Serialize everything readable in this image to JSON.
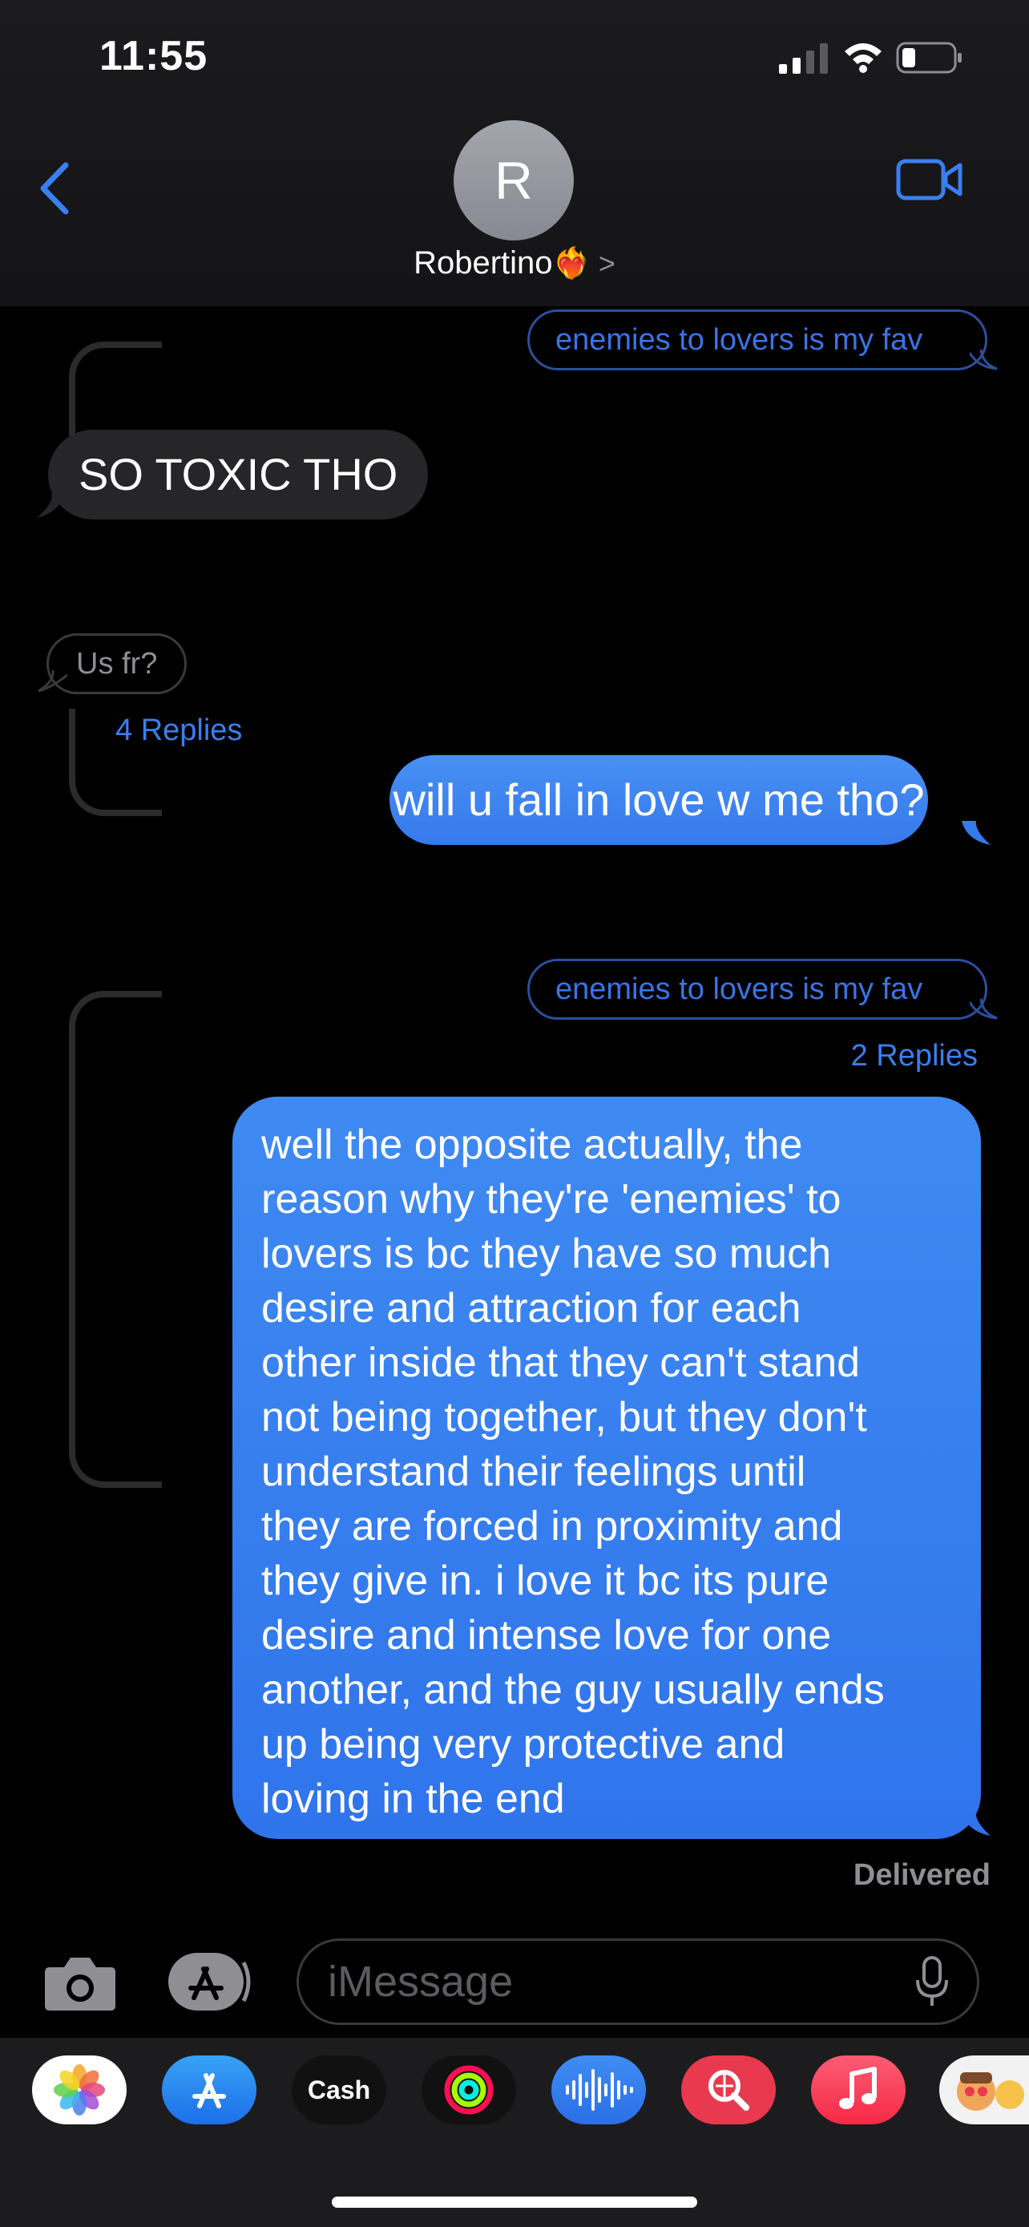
{
  "status": {
    "time": "11:55"
  },
  "header": {
    "avatar_initial": "R",
    "contact_name": "Robertino",
    "contact_emoji": "❤️‍🔥",
    "chevron": ">"
  },
  "messages": {
    "quote_top": "enemies to lovers is my fav",
    "toxic": "SO TOXIC THO",
    "us_fr": "Us fr?",
    "replies_1": "4 Replies",
    "fall_in_love": "will u fall in love w me tho?",
    "quote_second": "enemies to lovers is my fav",
    "replies_2": "2 Replies",
    "long_lines": [
      "well the opposite actually, the",
      "reason why they're 'enemies' to",
      "lovers is bc they have so much",
      "desire and attraction for each",
      "other inside that they can't stand",
      "not being together, but they don't",
      "understand their feelings until",
      "they are forced in proximity and",
      "they give in. i love it bc its pure",
      "desire and intense love for one",
      "another, and the guy usually ends",
      "up being very protective and",
      "loving in the end"
    ],
    "delivered": "Delivered"
  },
  "composer": {
    "placeholder": "iMessage"
  },
  "drawer": {
    "apps": [
      "photos",
      "app-store",
      "apple-cash",
      "activity",
      "audio-message",
      "image-search",
      "music",
      "memoji"
    ],
    "cash_label": "Cash"
  },
  "colors": {
    "blue": "#3a7ff0",
    "bubble_grey": "#262628",
    "background": "#000000"
  }
}
